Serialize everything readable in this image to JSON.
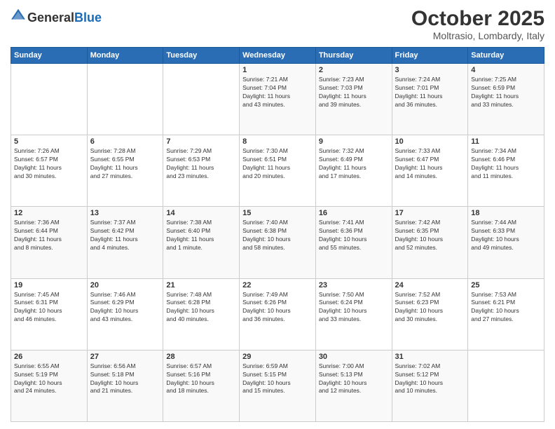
{
  "header": {
    "logo_general": "General",
    "logo_blue": "Blue",
    "month": "October 2025",
    "location": "Moltrasio, Lombardy, Italy"
  },
  "days_of_week": [
    "Sunday",
    "Monday",
    "Tuesday",
    "Wednesday",
    "Thursday",
    "Friday",
    "Saturday"
  ],
  "weeks": [
    [
      {
        "day": "",
        "info": ""
      },
      {
        "day": "",
        "info": ""
      },
      {
        "day": "",
        "info": ""
      },
      {
        "day": "1",
        "info": "Sunrise: 7:21 AM\nSunset: 7:04 PM\nDaylight: 11 hours\nand 43 minutes."
      },
      {
        "day": "2",
        "info": "Sunrise: 7:23 AM\nSunset: 7:03 PM\nDaylight: 11 hours\nand 39 minutes."
      },
      {
        "day": "3",
        "info": "Sunrise: 7:24 AM\nSunset: 7:01 PM\nDaylight: 11 hours\nand 36 minutes."
      },
      {
        "day": "4",
        "info": "Sunrise: 7:25 AM\nSunset: 6:59 PM\nDaylight: 11 hours\nand 33 minutes."
      }
    ],
    [
      {
        "day": "5",
        "info": "Sunrise: 7:26 AM\nSunset: 6:57 PM\nDaylight: 11 hours\nand 30 minutes."
      },
      {
        "day": "6",
        "info": "Sunrise: 7:28 AM\nSunset: 6:55 PM\nDaylight: 11 hours\nand 27 minutes."
      },
      {
        "day": "7",
        "info": "Sunrise: 7:29 AM\nSunset: 6:53 PM\nDaylight: 11 hours\nand 23 minutes."
      },
      {
        "day": "8",
        "info": "Sunrise: 7:30 AM\nSunset: 6:51 PM\nDaylight: 11 hours\nand 20 minutes."
      },
      {
        "day": "9",
        "info": "Sunrise: 7:32 AM\nSunset: 6:49 PM\nDaylight: 11 hours\nand 17 minutes."
      },
      {
        "day": "10",
        "info": "Sunrise: 7:33 AM\nSunset: 6:47 PM\nDaylight: 11 hours\nand 14 minutes."
      },
      {
        "day": "11",
        "info": "Sunrise: 7:34 AM\nSunset: 6:46 PM\nDaylight: 11 hours\nand 11 minutes."
      }
    ],
    [
      {
        "day": "12",
        "info": "Sunrise: 7:36 AM\nSunset: 6:44 PM\nDaylight: 11 hours\nand 8 minutes."
      },
      {
        "day": "13",
        "info": "Sunrise: 7:37 AM\nSunset: 6:42 PM\nDaylight: 11 hours\nand 4 minutes."
      },
      {
        "day": "14",
        "info": "Sunrise: 7:38 AM\nSunset: 6:40 PM\nDaylight: 11 hours\nand 1 minute."
      },
      {
        "day": "15",
        "info": "Sunrise: 7:40 AM\nSunset: 6:38 PM\nDaylight: 10 hours\nand 58 minutes."
      },
      {
        "day": "16",
        "info": "Sunrise: 7:41 AM\nSunset: 6:36 PM\nDaylight: 10 hours\nand 55 minutes."
      },
      {
        "day": "17",
        "info": "Sunrise: 7:42 AM\nSunset: 6:35 PM\nDaylight: 10 hours\nand 52 minutes."
      },
      {
        "day": "18",
        "info": "Sunrise: 7:44 AM\nSunset: 6:33 PM\nDaylight: 10 hours\nand 49 minutes."
      }
    ],
    [
      {
        "day": "19",
        "info": "Sunrise: 7:45 AM\nSunset: 6:31 PM\nDaylight: 10 hours\nand 46 minutes."
      },
      {
        "day": "20",
        "info": "Sunrise: 7:46 AM\nSunset: 6:29 PM\nDaylight: 10 hours\nand 43 minutes."
      },
      {
        "day": "21",
        "info": "Sunrise: 7:48 AM\nSunset: 6:28 PM\nDaylight: 10 hours\nand 40 minutes."
      },
      {
        "day": "22",
        "info": "Sunrise: 7:49 AM\nSunset: 6:26 PM\nDaylight: 10 hours\nand 36 minutes."
      },
      {
        "day": "23",
        "info": "Sunrise: 7:50 AM\nSunset: 6:24 PM\nDaylight: 10 hours\nand 33 minutes."
      },
      {
        "day": "24",
        "info": "Sunrise: 7:52 AM\nSunset: 6:23 PM\nDaylight: 10 hours\nand 30 minutes."
      },
      {
        "day": "25",
        "info": "Sunrise: 7:53 AM\nSunset: 6:21 PM\nDaylight: 10 hours\nand 27 minutes."
      }
    ],
    [
      {
        "day": "26",
        "info": "Sunrise: 6:55 AM\nSunset: 5:19 PM\nDaylight: 10 hours\nand 24 minutes."
      },
      {
        "day": "27",
        "info": "Sunrise: 6:56 AM\nSunset: 5:18 PM\nDaylight: 10 hours\nand 21 minutes."
      },
      {
        "day": "28",
        "info": "Sunrise: 6:57 AM\nSunset: 5:16 PM\nDaylight: 10 hours\nand 18 minutes."
      },
      {
        "day": "29",
        "info": "Sunrise: 6:59 AM\nSunset: 5:15 PM\nDaylight: 10 hours\nand 15 minutes."
      },
      {
        "day": "30",
        "info": "Sunrise: 7:00 AM\nSunset: 5:13 PM\nDaylight: 10 hours\nand 12 minutes."
      },
      {
        "day": "31",
        "info": "Sunrise: 7:02 AM\nSunset: 5:12 PM\nDaylight: 10 hours\nand 10 minutes."
      },
      {
        "day": "",
        "info": ""
      }
    ]
  ]
}
